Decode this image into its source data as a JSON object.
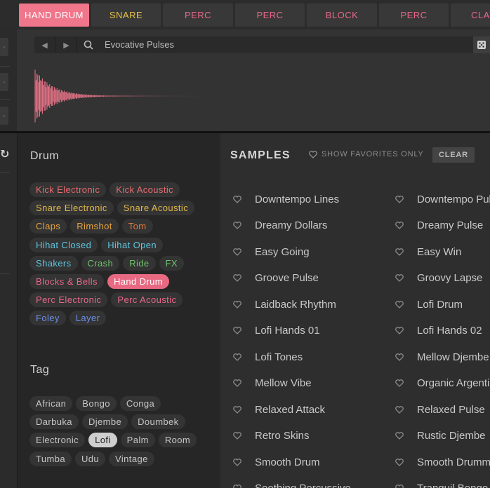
{
  "tabs": [
    "HAND DRUM",
    "SNARE",
    "PERC",
    "PERC",
    "BLOCK",
    "PERC",
    "CLAY"
  ],
  "tab_colors": [
    "#ffffff",
    "#e8c24a",
    "#e8688a",
    "#e8688a",
    "#e8688a",
    "#e8688a",
    "#e8688a"
  ],
  "browser": {
    "search_value": "Evocative Pulses"
  },
  "filter": {
    "drum_title": "Drum",
    "drum_rows": [
      [
        {
          "label": "Kick Electronic",
          "color": "#e86b70"
        },
        {
          "label": "Kick Acoustic",
          "color": "#e86b70"
        }
      ],
      [
        {
          "label": "Snare Electronic",
          "color": "#e2b84a"
        },
        {
          "label": "Snare Acoustic",
          "color": "#e2b84a"
        }
      ],
      [
        {
          "label": "Claps",
          "color": "#e8a23e"
        },
        {
          "label": "Rimshot",
          "color": "#e8a23e"
        },
        {
          "label": "Tom",
          "color": "#e0783e"
        }
      ],
      [
        {
          "label": "Hihat Closed",
          "color": "#5ec6e0"
        },
        {
          "label": "Hihat Open",
          "color": "#5ec6e0"
        }
      ],
      [
        {
          "label": "Shakers",
          "color": "#5ec6e0"
        },
        {
          "label": "Crash",
          "color": "#6ec46c"
        },
        {
          "label": "Ride",
          "color": "#6ec46c"
        },
        {
          "label": "FX",
          "color": "#6ec46c"
        }
      ],
      [
        {
          "label": "Blocks & Bells",
          "color": "#e8688a"
        },
        {
          "label": "Hand Drum",
          "color": "#ffffff",
          "selected": true
        }
      ],
      [
        {
          "label": "Perc Electronic",
          "color": "#e8688a"
        },
        {
          "label": "Perc Acoustic",
          "color": "#e8688a"
        }
      ],
      [
        {
          "label": "Foley",
          "color": "#6d8fe8"
        },
        {
          "label": "Layer",
          "color": "#6d8fe8"
        }
      ]
    ],
    "tag_title": "Tag",
    "tag_rows": [
      [
        {
          "label": "African"
        },
        {
          "label": "Bongo"
        },
        {
          "label": "Conga"
        }
      ],
      [
        {
          "label": "Darbuka"
        },
        {
          "label": "Djembe"
        },
        {
          "label": "Doumbek"
        }
      ],
      [
        {
          "label": "Electronic"
        },
        {
          "label": "Lofi",
          "selected": true
        },
        {
          "label": "Palm"
        },
        {
          "label": "Room"
        }
      ],
      [
        {
          "label": "Tumba"
        },
        {
          "label": "Udu"
        },
        {
          "label": "Vintage"
        }
      ]
    ]
  },
  "samples": {
    "title": "SAMPLES",
    "favorites_label": "SHOW FAVORITES ONLY",
    "clear_label": "CLEAR",
    "col1": [
      "Downtempo Lines",
      "Dreamy Dollars",
      "Easy Going",
      "Groove Pulse",
      "Laidback Rhythm",
      "Lofi Hands 01",
      "Lofi Tones",
      "Mellow Vibe",
      "Relaxed Attack",
      "Retro Skins",
      "Smooth Drum",
      "Soothing Percussive"
    ],
    "col2": [
      "Downtempo Pulse",
      "Dreamy Pulse",
      "Easy Win",
      "Groovy Lapse",
      "Lofi Drum",
      "Lofi Hands 02",
      "Mellow Djembe",
      "Organic Argentine",
      "Relaxed Pulse",
      "Rustic Djembe",
      "Smooth Drummer",
      "Tranquil Bongo"
    ]
  }
}
